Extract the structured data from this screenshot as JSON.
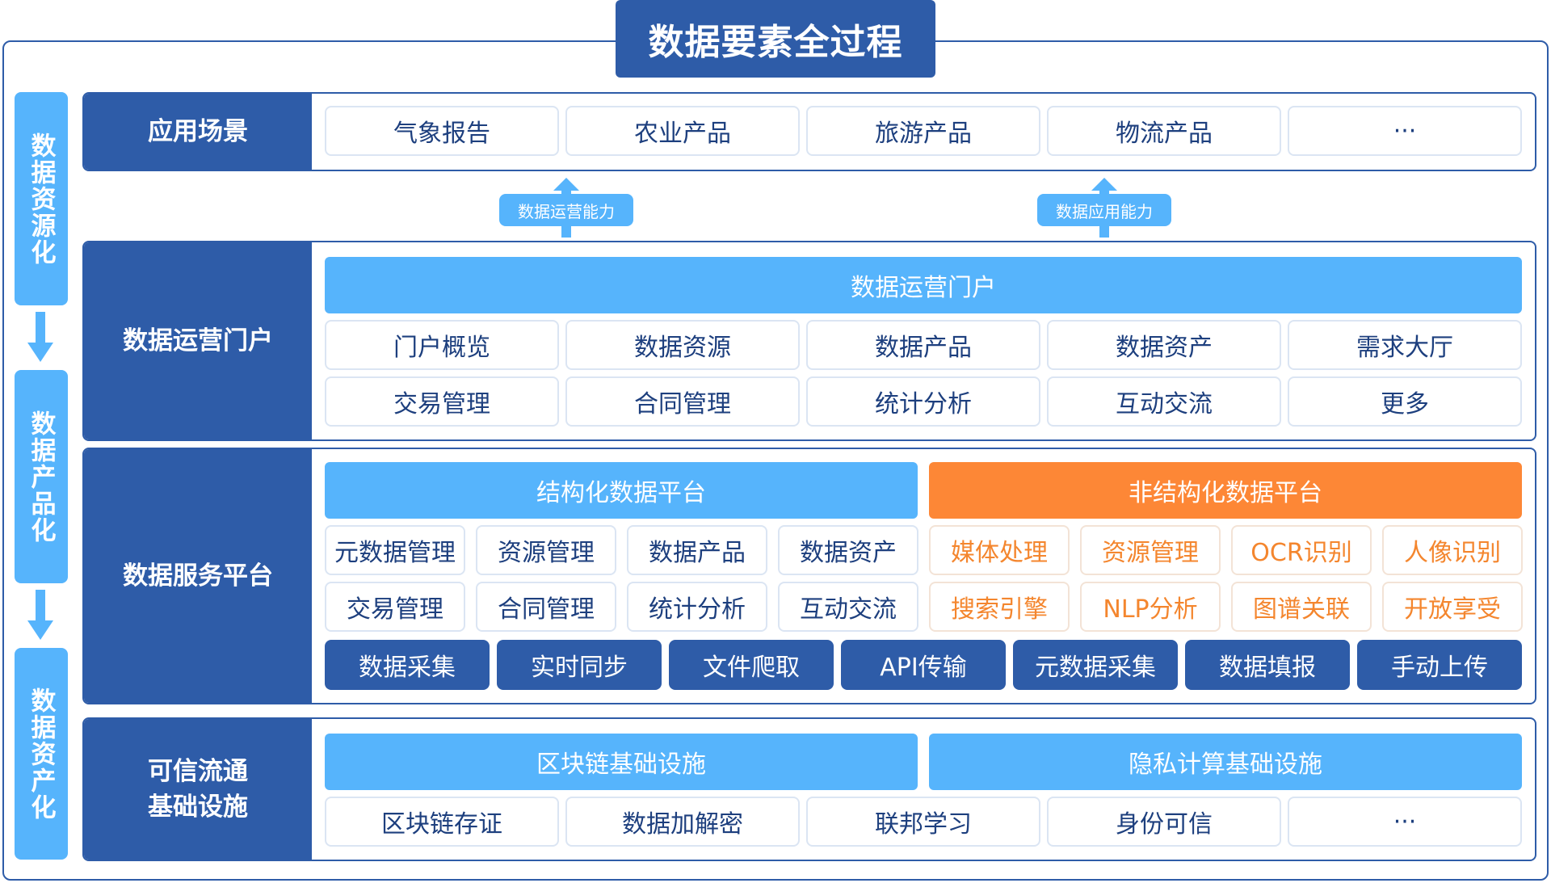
{
  "title": "数据要素全过程",
  "stages": [
    "数据资源化",
    "数据产品化",
    "数据资产化"
  ],
  "capabilities": [
    "数据运营能力",
    "数据应用能力"
  ],
  "layers": {
    "app": {
      "label": "应用场景",
      "items": [
        "气象报告",
        "农业产品",
        "旅游产品",
        "物流产品",
        "···"
      ]
    },
    "portal": {
      "label": "数据运营门户",
      "bar": "数据运营门户",
      "row1": [
        "门户概览",
        "数据资源",
        "数据产品",
        "数据资产",
        "需求大厅"
      ],
      "row2": [
        "交易管理",
        "合同管理",
        "统计分析",
        "互动交流",
        "更多"
      ]
    },
    "service": {
      "label": "数据服务平台",
      "structured": {
        "bar": "结构化数据平台",
        "row1": [
          "元数据管理",
          "资源管理",
          "数据产品",
          "数据资产"
        ],
        "row2": [
          "交易管理",
          "合同管理",
          "统计分析",
          "互动交流"
        ]
      },
      "unstructured": {
        "bar": "非结构化数据平台",
        "row1": [
          "媒体处理",
          "资源管理",
          "OCR识别",
          "人像识别"
        ],
        "row2": [
          "搜索引擎",
          "NLP分析",
          "图谱关联",
          "开放享受"
        ]
      },
      "collect": [
        "数据采集",
        "实时同步",
        "文件爬取",
        "API传输",
        "元数据采集",
        "数据填报",
        "手动上传"
      ]
    },
    "infra": {
      "label": "可信流通\n基础设施",
      "bars": [
        "区块链基础设施",
        "隐私计算基础设施"
      ],
      "items": [
        "区块链存证",
        "数据加解密",
        "联邦学习",
        "身份可信",
        "···"
      ]
    }
  },
  "colors": {
    "dark_blue": "#2e5ca8",
    "light_blue": "#56b4fc",
    "orange": "#fd8736",
    "cell_text": "#1d3f7e"
  }
}
